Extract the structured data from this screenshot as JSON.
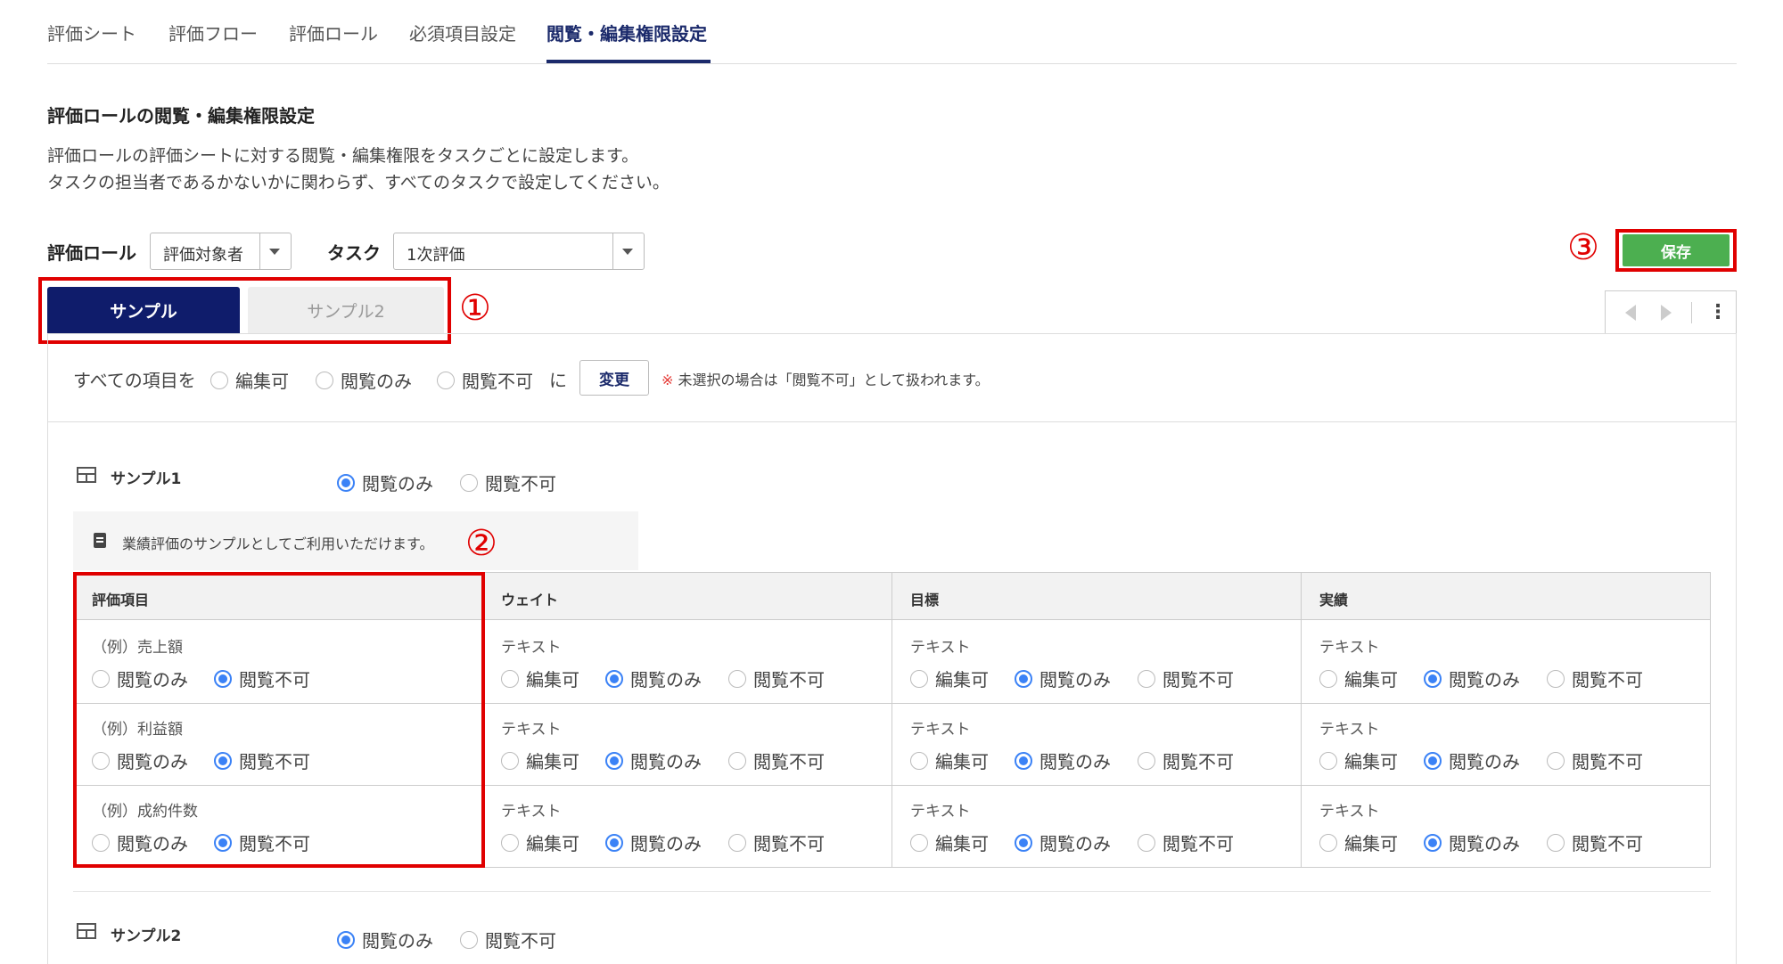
{
  "nav": {
    "tabs": [
      "評価シート",
      "評価フロー",
      "評価ロール",
      "必須項目設定",
      "閲覧・編集権限設定"
    ],
    "active_index": 4
  },
  "page": {
    "heading": "評価ロールの閲覧・編集権限設定",
    "desc1": "評価ロールの評価シートに対する閲覧・編集権限をタスクごとに設定します。",
    "desc2": "タスクの担当者であるかないかに関わらず、すべてのタスクで設定してください。"
  },
  "filters": {
    "role_label": "評価ロール",
    "role_value": "評価対象者",
    "task_label": "タスク",
    "task_value": "1次評価"
  },
  "save_label": "保存",
  "annotations": [
    "①",
    "②",
    "③"
  ],
  "sheet_tabs": [
    "サンプル",
    "サンプル2"
  ],
  "bulk": {
    "label": "すべての項目を",
    "options": [
      "編集可",
      "閲覧のみ",
      "閲覧不可"
    ],
    "ni": "に",
    "change_label": "変更",
    "note_mark": "※",
    "note": "未選択の場合は「閲覧不可」として扱われます。"
  },
  "sections": [
    {
      "title": "サンプル1",
      "options": [
        "閲覧のみ",
        "閲覧不可"
      ],
      "selected": 0
    },
    {
      "title": "サンプル2",
      "options": [
        "閲覧のみ",
        "閲覧不可"
      ],
      "selected": 0
    }
  ],
  "info_text": "業績評価のサンプルとしてご利用いただけます。",
  "table": {
    "headers": [
      "評価項目",
      "ウェイト",
      "目標",
      "実績"
    ],
    "rows": [
      {
        "item": "（例）売上額"
      },
      {
        "item": "（例）利益額"
      },
      {
        "item": "（例）成約件数"
      }
    ],
    "item_options": [
      "閲覧のみ",
      "閲覧不可"
    ],
    "item_selected": 1,
    "cell_type": "テキスト",
    "cell_options": [
      "編集可",
      "閲覧のみ",
      "閲覧不可"
    ],
    "cell_selected": 1
  },
  "colors": {
    "nav_active": "#1b2a6b",
    "tab_active_bg": "#0f1c6b",
    "save_bg": "#4caf50",
    "annotation_red": "#e00000",
    "radio_selected": "#3b82f6"
  }
}
